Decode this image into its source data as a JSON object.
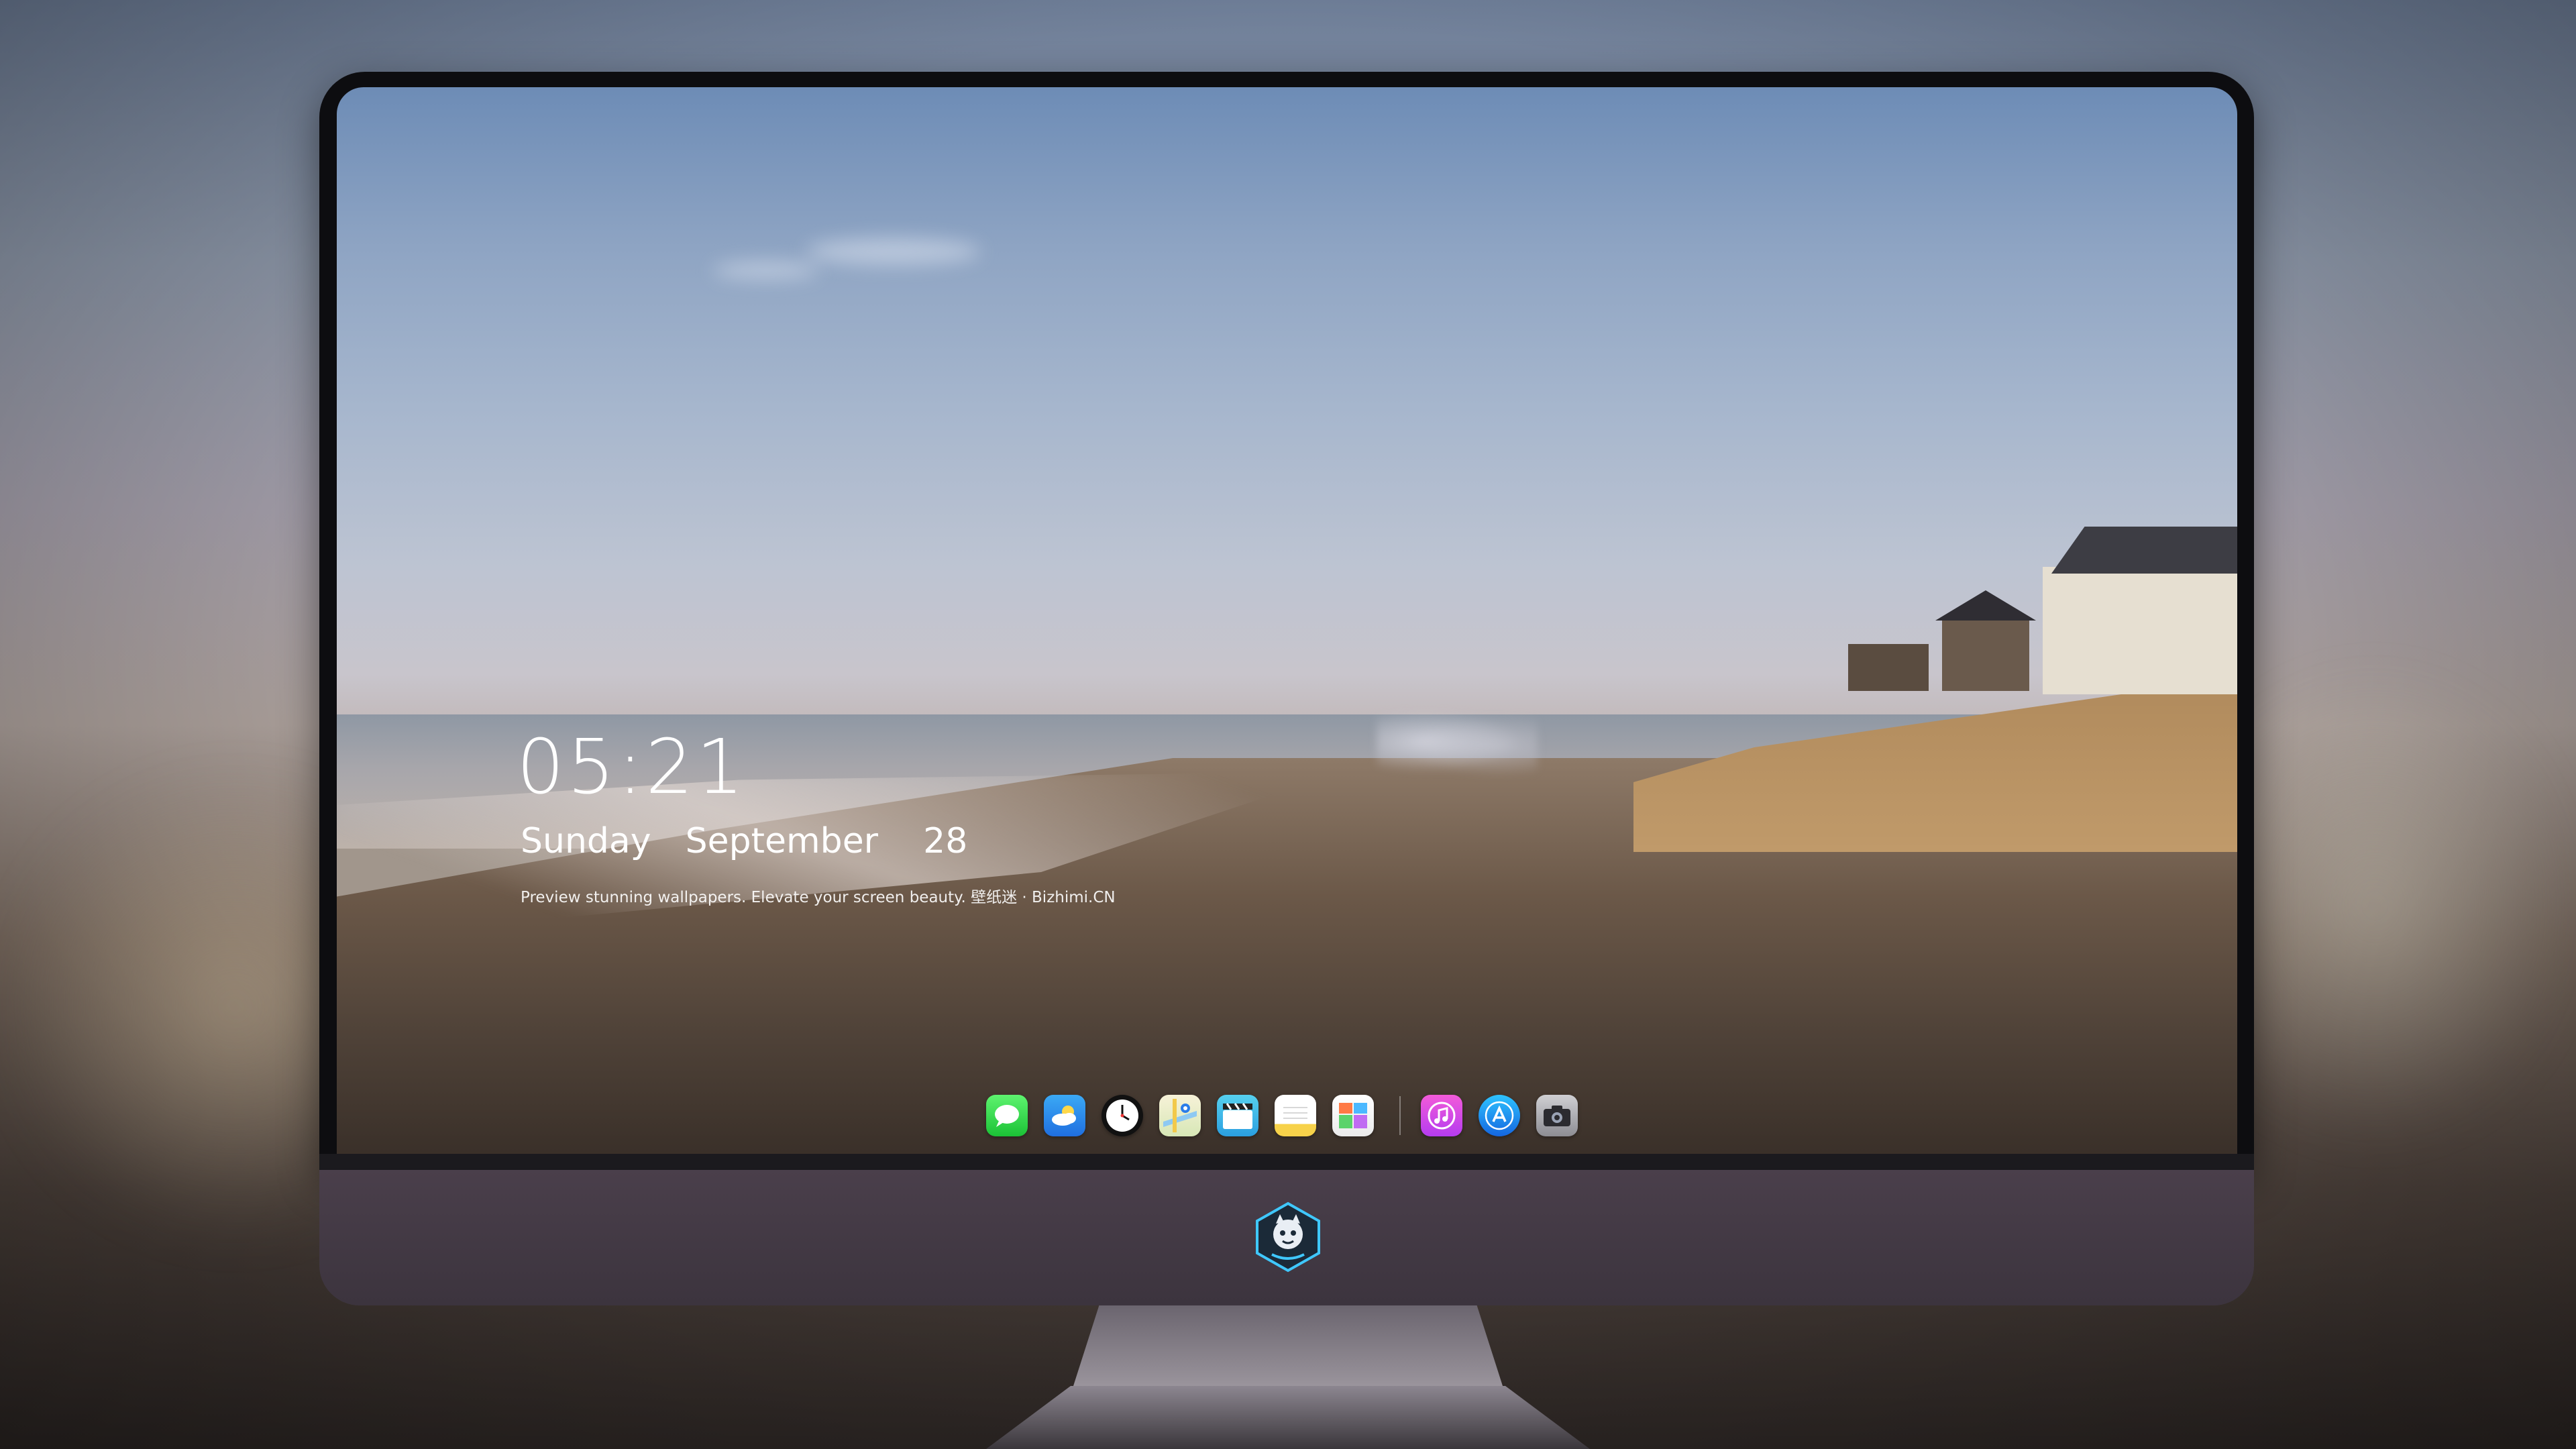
{
  "lockscreen": {
    "time": "05:21",
    "weekday": "Sunday",
    "month": "September",
    "day": "28",
    "tagline": "Preview stunning wallpapers. Elevate your screen beauty. 壁纸迷 · Bizhimi.CN"
  },
  "dock": {
    "apps": [
      {
        "name": "messages",
        "icon": "message-bubble-icon"
      },
      {
        "name": "weather",
        "icon": "cloud-sun-icon"
      },
      {
        "name": "clock",
        "icon": "clock-icon"
      },
      {
        "name": "maps",
        "icon": "map-icon"
      },
      {
        "name": "clips",
        "icon": "clapperboard-icon"
      },
      {
        "name": "notes",
        "icon": "notepad-icon"
      },
      {
        "name": "photos",
        "icon": "photo-collage-icon"
      },
      {
        "name": "music",
        "icon": "music-note-icon"
      },
      {
        "name": "app-store",
        "icon": "app-store-icon"
      },
      {
        "name": "camera",
        "icon": "camera-icon"
      }
    ]
  },
  "colors": {
    "bezel": "#0d0d10",
    "chin": "#4a3f4b",
    "text": "#ffffff",
    "logo_accent": "#3fc8ff"
  }
}
